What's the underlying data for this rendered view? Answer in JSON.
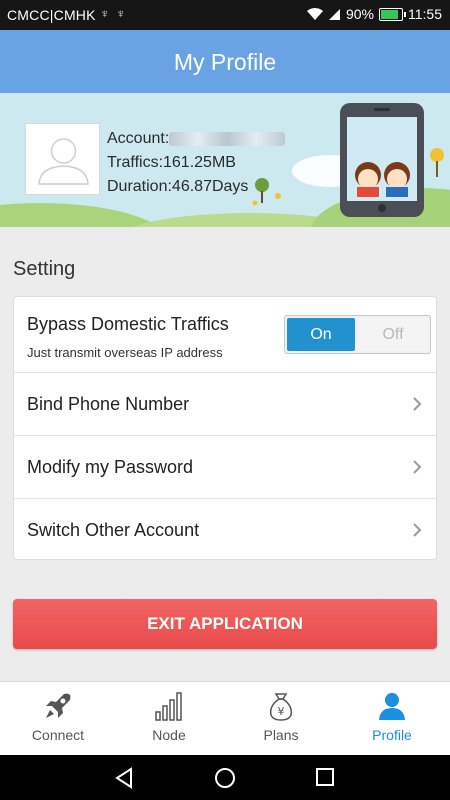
{
  "status_bar": {
    "carrier": "CMCC|CMHK",
    "usb_icons": "♆ ♆",
    "battery": "90%",
    "battery_level": 0.9,
    "time": "11:55"
  },
  "header": {
    "title": "My Profile"
  },
  "profile": {
    "account_label": "Account:",
    "traffics": "Traffics:161.25MB",
    "duration": "Duration:46.87Days"
  },
  "settings": {
    "section_title": "Setting",
    "bypass": {
      "label": "Bypass Domestic Traffics",
      "sub": "Just transmit overseas IP address",
      "on_label": "On",
      "off_label": "Off",
      "active_color": "#2291cf"
    },
    "items": [
      {
        "label": "Bind Phone Number"
      },
      {
        "label": "Modify my Password"
      },
      {
        "label": "Switch Other Account"
      }
    ]
  },
  "exit_button": {
    "label": "EXIT APPLICATION",
    "color": "#ee5555"
  },
  "bottom_nav": {
    "tabs": [
      {
        "label": "Connect",
        "icon": "rocket-icon"
      },
      {
        "label": "Node",
        "icon": "signal-bars-icon"
      },
      {
        "label": "Plans",
        "icon": "money-bag-icon"
      },
      {
        "label": "Profile",
        "icon": "person-icon",
        "active": true
      }
    ],
    "active_color": "#1c8fde"
  },
  "header_color": "#6aa3e4"
}
